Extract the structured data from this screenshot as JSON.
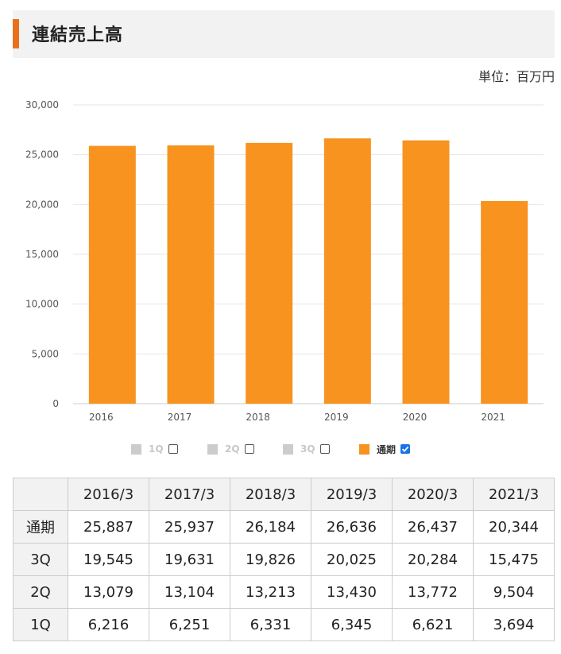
{
  "header": {
    "title": "連結売上高"
  },
  "unit_label": "単位：百万円",
  "colors": {
    "accent": "#e8711d",
    "bar": "#f7931e",
    "legend_inactive": "#cccccc",
    "header_bg": "#f2f2f2"
  },
  "chart_data": {
    "type": "bar",
    "categories": [
      "2016",
      "2017",
      "2018",
      "2019",
      "2020",
      "2021"
    ],
    "series": [
      {
        "name": "通期",
        "values": [
          25887,
          25937,
          26184,
          26636,
          26437,
          20344
        ]
      }
    ],
    "ylim": [
      0,
      30000
    ],
    "yticks": [
      "0",
      "5,000",
      "10,000",
      "15,000",
      "20,000",
      "25,000",
      "30,000"
    ],
    "xlabel": "",
    "ylabel": "",
    "grid": true
  },
  "legend": [
    {
      "label": "1Q",
      "checked": false,
      "color": "#cccccc"
    },
    {
      "label": "2Q",
      "checked": false,
      "color": "#cccccc"
    },
    {
      "label": "3Q",
      "checked": false,
      "color": "#cccccc"
    },
    {
      "label": "通期",
      "checked": true,
      "color": "#f7931e"
    }
  ],
  "table": {
    "columns": [
      "2016/3",
      "2017/3",
      "2018/3",
      "2019/3",
      "2020/3",
      "2021/3"
    ],
    "rows": [
      {
        "label": "通期",
        "values": [
          "25,887",
          "25,937",
          "26,184",
          "26,636",
          "26,437",
          "20,344"
        ]
      },
      {
        "label": "3Q",
        "values": [
          "19,545",
          "19,631",
          "19,826",
          "20,025",
          "20,284",
          "15,475"
        ]
      },
      {
        "label": "2Q",
        "values": [
          "13,079",
          "13,104",
          "13,213",
          "13,430",
          "13,772",
          "9,504"
        ]
      },
      {
        "label": "1Q",
        "values": [
          "6,216",
          "6,251",
          "6,331",
          "6,345",
          "6,621",
          "3,694"
        ]
      }
    ]
  }
}
